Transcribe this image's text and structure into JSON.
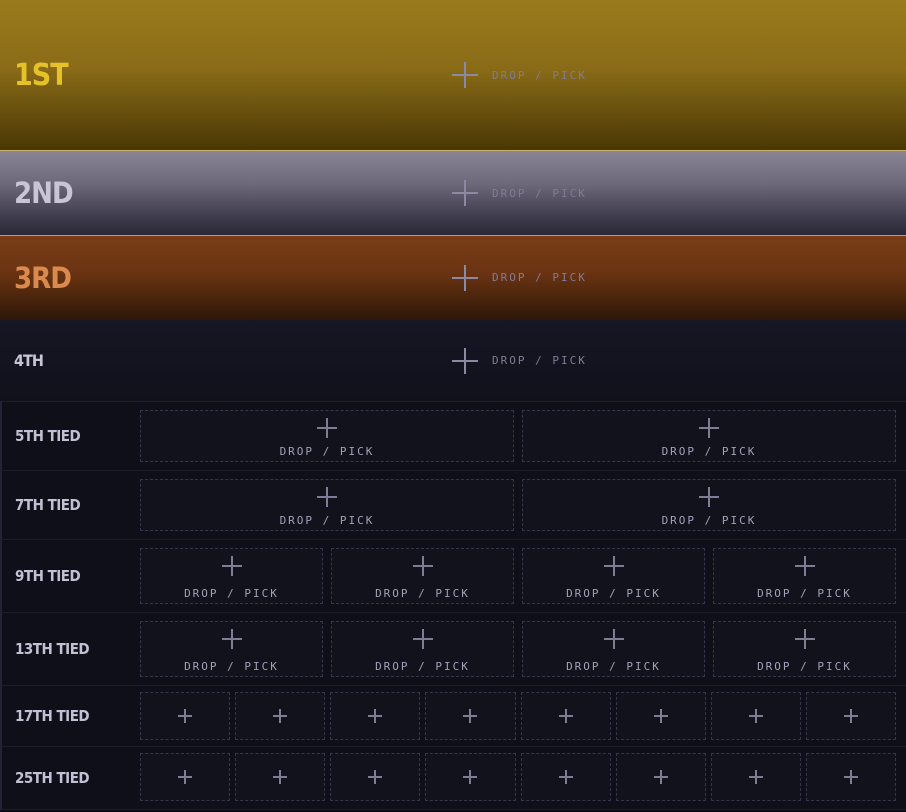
{
  "slot_text": "DROP / PICK",
  "tiers": [
    {
      "label": "1ST"
    },
    {
      "label": "2ND"
    },
    {
      "label": "3RD"
    },
    {
      "label": "4TH"
    }
  ],
  "rows": [
    {
      "label": "5TH TIED",
      "slots": 2
    },
    {
      "label": "7TH TIED",
      "slots": 2
    },
    {
      "label": "9TH TIED",
      "slots": 4
    },
    {
      "label": "13TH TIED",
      "slots": 4
    },
    {
      "label": "17TH TIED",
      "slots": 8
    },
    {
      "label": "25TH TIED",
      "slots": 8
    }
  ],
  "colors": {
    "gold": "#e6c229",
    "silver": "#c9c4d6",
    "bronze": "#d98a4c",
    "background": "#0d0e17",
    "dashed_border": "#35354d"
  }
}
